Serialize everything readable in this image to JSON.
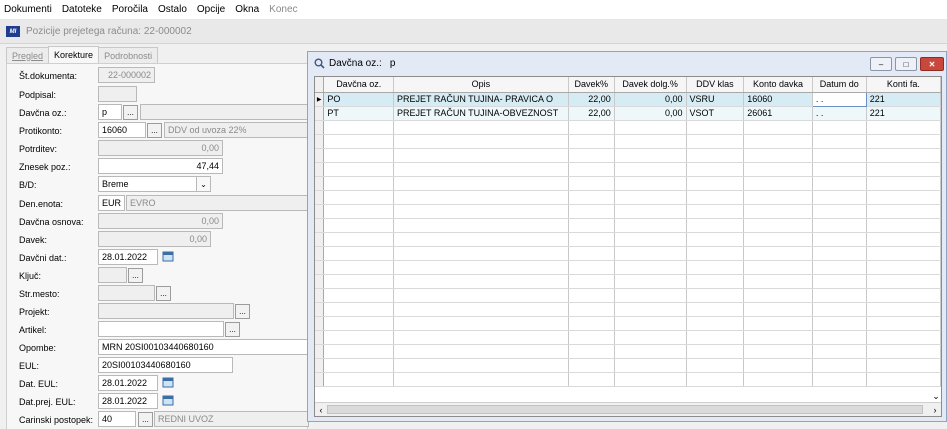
{
  "menu": [
    "Dokumenti",
    "Datoteke",
    "Poročila",
    "Ostalo",
    "Opcije",
    "Okna",
    "Konec"
  ],
  "window_title": "Pozicije prejetega računa: 22-000002",
  "app_logo_text": "MI",
  "tabs": [
    "Pregled",
    "Korekture",
    "Podrobnosti"
  ],
  "form": {
    "st_dokumenta": {
      "label": "Št.dokumenta:",
      "value": "22-000002"
    },
    "podpisal": {
      "label": "Podpisal:",
      "value": ""
    },
    "davcna_oz": {
      "label": "Davčna oz.:",
      "value": "p",
      "desc": ""
    },
    "protikonto": {
      "label": "Protikonto:",
      "value": "16060",
      "desc": "DDV od uvoza 22%"
    },
    "potrditev": {
      "label": "Potrditev:",
      "value": "0,00"
    },
    "znesek_poz": {
      "label": "Znesek poz.:",
      "value": "47,44"
    },
    "bd": {
      "label": "B/D:",
      "value": "Breme"
    },
    "den_enota": {
      "label": "Den.enota:",
      "value": "EUR",
      "desc": "EVRO"
    },
    "davcna_osnova": {
      "label": "Davčna osnova:",
      "value": "0,00"
    },
    "davek": {
      "label": "Davek:",
      "value": "0,00"
    },
    "davcni_dat": {
      "label": "Davčni dat.:",
      "value": "28.01.2022"
    },
    "kljuc": {
      "label": "Ključ:",
      "value": ""
    },
    "str_mesto": {
      "label": "Str.mesto:",
      "value": ""
    },
    "projekt": {
      "label": "Projekt:",
      "value": ""
    },
    "artikel": {
      "label": "Artikel:",
      "value": ""
    },
    "opombe": {
      "label": "Opombe:",
      "value": "MRN 20SI00103440680160"
    },
    "eul": {
      "label": "EUL:",
      "value": "20SI00103440680160"
    },
    "dat_eul": {
      "label": "Dat. EUL:",
      "value": "28.01.2022"
    },
    "dat_prej_eul": {
      "label": "Dat.prej. EUL:",
      "value": "28.01.2022"
    },
    "carinski_postopek": {
      "label": "Carinski postopek:",
      "value": "40",
      "desc": "REDNI UVOZ"
    }
  },
  "lookup": {
    "title": "Davčna oz.:",
    "filter": "p",
    "columns": [
      "Davčna oz.",
      "Opis",
      "Davek%",
      "Davek dolg.%",
      "DDV klas",
      "Konto davka",
      "Datum do",
      "Konti fa."
    ],
    "rows": [
      {
        "code": "PO",
        "opis": "PREJET RAČUN TUJINA- PRAVICA O",
        "davek": "22,00",
        "davek_dolg": "0,00",
        "ddv_klas": "VSRU",
        "konto": "16060",
        "datum_do": ". .",
        "konti_fa": "221"
      },
      {
        "code": "PT",
        "opis": "PREJET RAČUN TUJINA-OBVEZNOST",
        "davek": "22,00",
        "davek_dolg": "0,00",
        "ddv_klas": "VSOT",
        "konto": "26061",
        "datum_do": ". .",
        "konti_fa": "221"
      }
    ]
  },
  "icons": {
    "search": "magnifier-icon",
    "calendar": "calendar-icon"
  }
}
